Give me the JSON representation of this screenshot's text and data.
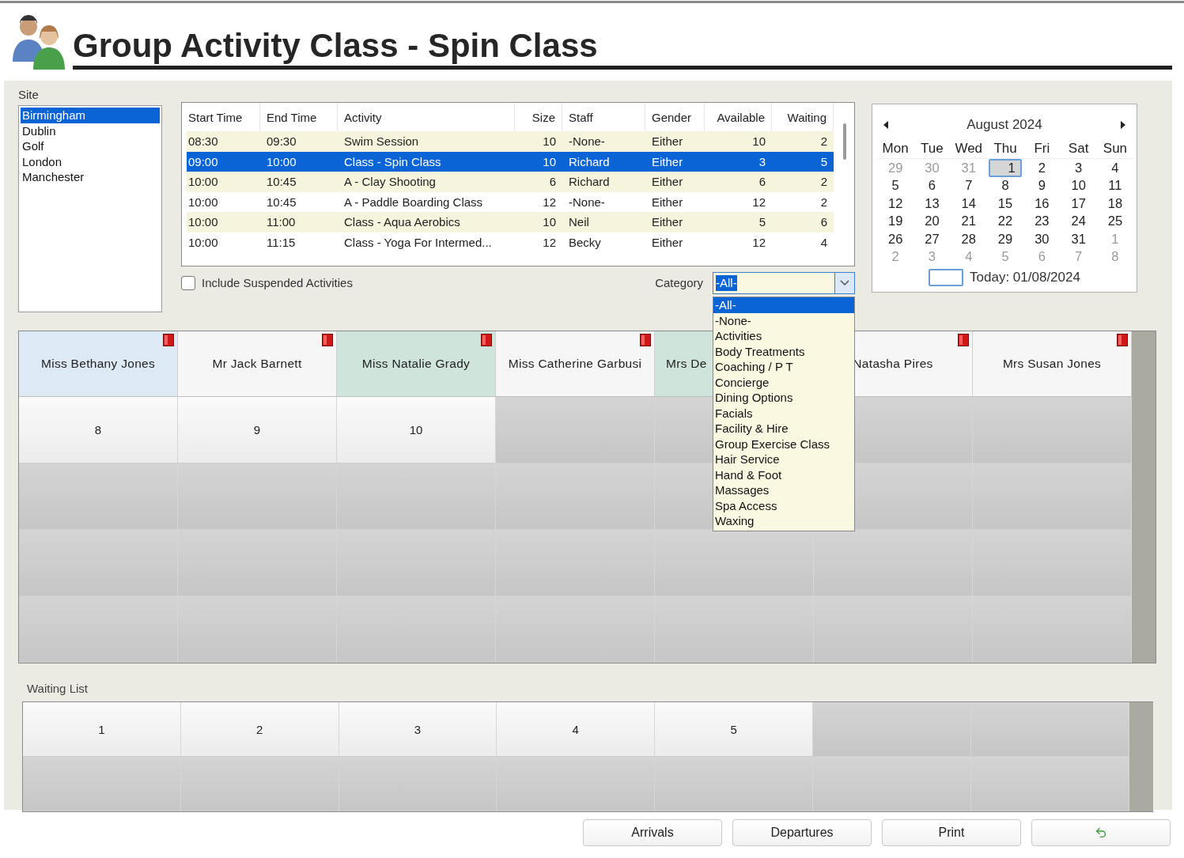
{
  "title": "Group Activity Class - Spin Class",
  "site": {
    "label": "Site",
    "items": [
      {
        "label": "Birmingham",
        "selected": true
      },
      {
        "label": "Dublin",
        "selected": false
      },
      {
        "label": "Golf",
        "selected": false
      },
      {
        "label": "London",
        "selected": false
      },
      {
        "label": "Manchester",
        "selected": false
      }
    ]
  },
  "table": {
    "columns": [
      {
        "label": "Start Time",
        "numeric": false
      },
      {
        "label": "End Time",
        "numeric": false
      },
      {
        "label": "Activity",
        "numeric": false
      },
      {
        "label": "Size",
        "numeric": true
      },
      {
        "label": "Staff",
        "numeric": false
      },
      {
        "label": "Gender",
        "numeric": false
      },
      {
        "label": "Available",
        "numeric": true
      },
      {
        "label": "Waiting",
        "numeric": true
      }
    ],
    "rows": [
      {
        "cells": [
          "08:30",
          "09:30",
          "Swim Session",
          "10",
          "-None-",
          "Either",
          "10",
          "2"
        ],
        "selected": false
      },
      {
        "cells": [
          "09:00",
          "10:00",
          "Class - Spin Class",
          "10",
          "Richard",
          "Either",
          "3",
          "5"
        ],
        "selected": true
      },
      {
        "cells": [
          "10:00",
          "10:45",
          "A - Clay Shooting",
          "6",
          "Richard",
          "Either",
          "6",
          "2"
        ],
        "selected": false
      },
      {
        "cells": [
          "10:00",
          "10:45",
          "A - Paddle Boarding Class",
          "12",
          "-None-",
          "Either",
          "12",
          "2"
        ],
        "selected": false
      },
      {
        "cells": [
          "10:00",
          "11:00",
          "Class - Aqua Aerobics",
          "10",
          "Neil",
          "Either",
          "5",
          "6"
        ],
        "selected": false
      },
      {
        "cells": [
          "10:00",
          "11:15",
          "Class - Yoga For Intermed...",
          "12",
          "Becky",
          "Either",
          "12",
          "4"
        ],
        "selected": false
      }
    ]
  },
  "suspended": {
    "label": "Include Suspended Activities",
    "checked": false
  },
  "category": {
    "label": "Category",
    "value": "-All-",
    "expanded": true,
    "options": [
      {
        "label": "-All-",
        "selected": true
      },
      {
        "label": "-None-",
        "selected": false
      },
      {
        "label": "Activities",
        "selected": false
      },
      {
        "label": "Body Treatments",
        "selected": false
      },
      {
        "label": "Coaching / P T",
        "selected": false
      },
      {
        "label": "Concierge",
        "selected": false
      },
      {
        "label": "Dining Options",
        "selected": false
      },
      {
        "label": "Facials",
        "selected": false
      },
      {
        "label": "Facility & Hire",
        "selected": false
      },
      {
        "label": "Group Exercise Class",
        "selected": false
      },
      {
        "label": "Hair Service",
        "selected": false
      },
      {
        "label": "Hand & Foot",
        "selected": false
      },
      {
        "label": "Massages",
        "selected": false
      },
      {
        "label": "Spa Access",
        "selected": false
      },
      {
        "label": "Waxing",
        "selected": false
      }
    ]
  },
  "calendar": {
    "month": "August 2024",
    "weekdays": [
      "Mon",
      "Tue",
      "Wed",
      "Thu",
      "Fri",
      "Sat",
      "Sun"
    ],
    "days": [
      {
        "label": "29",
        "muted": true,
        "selected": false
      },
      {
        "label": "30",
        "muted": true,
        "selected": false
      },
      {
        "label": "31",
        "muted": true,
        "selected": false
      },
      {
        "label": "1",
        "muted": false,
        "selected": true
      },
      {
        "label": "2",
        "muted": false,
        "selected": false
      },
      {
        "label": "3",
        "muted": false,
        "selected": false
      },
      {
        "label": "4",
        "muted": false,
        "selected": false
      },
      {
        "label": "5",
        "muted": false,
        "selected": false
      },
      {
        "label": "6",
        "muted": false,
        "selected": false
      },
      {
        "label": "7",
        "muted": false,
        "selected": false
      },
      {
        "label": "8",
        "muted": false,
        "selected": false
      },
      {
        "label": "9",
        "muted": false,
        "selected": false
      },
      {
        "label": "10",
        "muted": false,
        "selected": false
      },
      {
        "label": "11",
        "muted": false,
        "selected": false
      },
      {
        "label": "12",
        "muted": false,
        "selected": false
      },
      {
        "label": "13",
        "muted": false,
        "selected": false
      },
      {
        "label": "14",
        "muted": false,
        "selected": false
      },
      {
        "label": "15",
        "muted": false,
        "selected": false
      },
      {
        "label": "16",
        "muted": false,
        "selected": false
      },
      {
        "label": "17",
        "muted": false,
        "selected": false
      },
      {
        "label": "18",
        "muted": false,
        "selected": false
      },
      {
        "label": "19",
        "muted": false,
        "selected": false
      },
      {
        "label": "20",
        "muted": false,
        "selected": false
      },
      {
        "label": "21",
        "muted": false,
        "selected": false
      },
      {
        "label": "22",
        "muted": false,
        "selected": false
      },
      {
        "label": "23",
        "muted": false,
        "selected": false
      },
      {
        "label": "24",
        "muted": false,
        "selected": false
      },
      {
        "label": "25",
        "muted": false,
        "selected": false
      },
      {
        "label": "26",
        "muted": false,
        "selected": false
      },
      {
        "label": "27",
        "muted": false,
        "selected": false
      },
      {
        "label": "28",
        "muted": false,
        "selected": false
      },
      {
        "label": "29",
        "muted": false,
        "selected": false
      },
      {
        "label": "30",
        "muted": false,
        "selected": false
      },
      {
        "label": "31",
        "muted": false,
        "selected": false
      },
      {
        "label": "1",
        "muted": true,
        "selected": false
      },
      {
        "label": "2",
        "muted": true,
        "selected": false
      },
      {
        "label": "3",
        "muted": true,
        "selected": false
      },
      {
        "label": "4",
        "muted": true,
        "selected": false
      },
      {
        "label": "5",
        "muted": true,
        "selected": false
      },
      {
        "label": "6",
        "muted": true,
        "selected": false
      },
      {
        "label": "7",
        "muted": true,
        "selected": false
      },
      {
        "label": "8",
        "muted": true,
        "selected": false
      }
    ],
    "today": "Today: 01/08/2024"
  },
  "booking_grid": {
    "staff": [
      {
        "name": "Miss Bethany Jones",
        "color": "#dde9f4",
        "truncated": false
      },
      {
        "name": "Mr Jack Barnett",
        "color": "#f6f6f6",
        "truncated": false
      },
      {
        "name": "Miss Natalie Grady",
        "color": "#cfe5dc",
        "truncated": false
      },
      {
        "name": "Miss Catherine Garbusi",
        "color": "#f6f6f6",
        "truncated": false
      },
      {
        "name": "Mrs De",
        "color": "#cfe5dc",
        "truncated": true
      },
      {
        "name": "Natasha Pires",
        "color": "#f6f6f6",
        "truncated": false
      },
      {
        "name": "Mrs Susan Jones",
        "color": "#f6f6f6",
        "truncated": false
      }
    ],
    "rows": [
      [
        {
          "label": "8",
          "open": true
        },
        {
          "label": "9",
          "open": true
        },
        {
          "label": "10",
          "open": true
        },
        {
          "open": false
        },
        {
          "open": false
        },
        {
          "open": false
        },
        {
          "open": false
        }
      ],
      [
        {
          "open": false
        },
        {
          "open": false
        },
        {
          "open": false
        },
        {
          "open": false
        },
        {
          "open": false
        },
        {
          "open": false
        },
        {
          "open": false
        }
      ],
      [
        {
          "open": false
        },
        {
          "open": false
        },
        {
          "open": false
        },
        {
          "open": false
        },
        {
          "open": false
        },
        {
          "open": false
        },
        {
          "open": false
        }
      ],
      [
        {
          "open": false
        },
        {
          "open": false
        },
        {
          "open": false
        },
        {
          "open": false
        },
        {
          "open": false
        },
        {
          "open": false
        },
        {
          "open": false
        }
      ]
    ]
  },
  "waiting_list": {
    "label": "Waiting List",
    "rows": [
      [
        {
          "label": "1",
          "open": true
        },
        {
          "label": "2",
          "open": true
        },
        {
          "label": "3",
          "open": true
        },
        {
          "label": "4",
          "open": true
        },
        {
          "label": "5",
          "open": true
        },
        {
          "open": false
        },
        {
          "open": false
        }
      ],
      [
        {
          "open": false
        },
        {
          "open": false
        },
        {
          "open": false
        },
        {
          "open": false
        },
        {
          "open": false
        },
        {
          "open": false
        },
        {
          "open": false
        }
      ]
    ]
  },
  "buttons": [
    {
      "kind": "text",
      "label": "Arrivals"
    },
    {
      "kind": "text",
      "label": "Departures"
    },
    {
      "kind": "text",
      "label": "Print"
    },
    {
      "kind": "undo"
    }
  ]
}
